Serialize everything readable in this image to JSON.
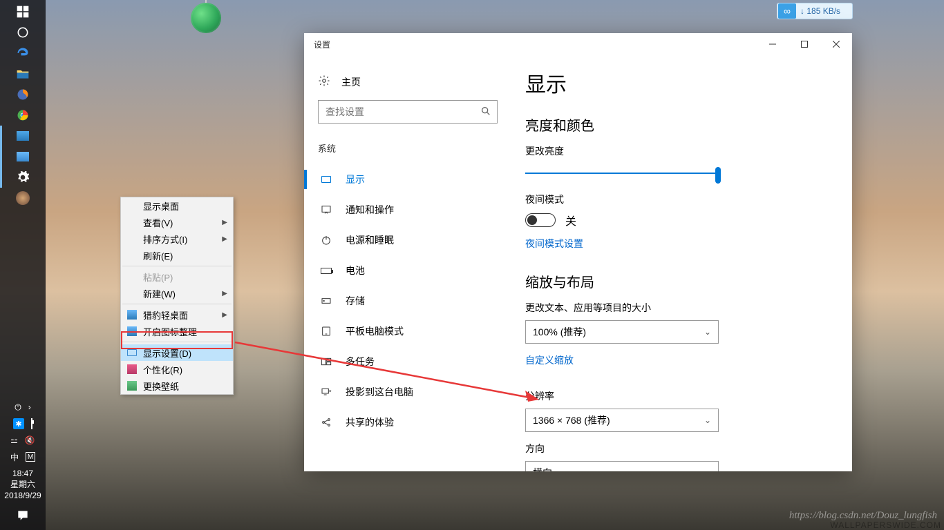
{
  "taskbar": {
    "clock_time": "18:47",
    "clock_day": "星期六",
    "clock_date": "2018/9/29",
    "ime": "中",
    "ime2": "M"
  },
  "netwidget": {
    "speed": "185 KB/s",
    "arrow": "↓"
  },
  "ctxmenu": {
    "items": [
      {
        "label": "显示桌面",
        "arrow": false
      },
      {
        "label": "查看(V)",
        "arrow": true
      },
      {
        "label": "排序方式(I)",
        "arrow": true
      },
      {
        "label": "刷新(E)",
        "arrow": false
      }
    ],
    "items2": [
      {
        "label": "粘贴(P)",
        "disabled": true
      },
      {
        "label": "新建(W)",
        "arrow": true
      }
    ],
    "items3": [
      {
        "label": "猎豹轻桌面",
        "arrow": true,
        "ico": "color1"
      },
      {
        "label": "开启图标整理",
        "ico": "color2"
      }
    ],
    "items4": [
      {
        "label": "显示设置(D)",
        "ico": "display",
        "hl": true
      },
      {
        "label": "个性化(R)",
        "ico": "pers"
      },
      {
        "label": "更换壁纸",
        "ico": "wall"
      }
    ]
  },
  "settings": {
    "title": "设置",
    "nav": {
      "home": "主页",
      "search_placeholder": "查找设置",
      "section": "系统",
      "items": [
        "显示",
        "通知和操作",
        "电源和睡眠",
        "电池",
        "存储",
        "平板电脑模式",
        "多任务",
        "投影到这台电脑",
        "共享的体验"
      ]
    },
    "content": {
      "h1": "显示",
      "section1": "亮度和颜色",
      "brightness_label": "更改亮度",
      "night_label": "夜间模式",
      "toggle_state": "关",
      "night_link": "夜间模式设置",
      "section2": "缩放与布局",
      "scale_label": "更改文本、应用等项目的大小",
      "scale_value": "100% (推荐)",
      "custom_scale": "自定义缩放",
      "res_label": "分辨率",
      "res_value": "1366 × 768 (推荐)",
      "orient_label": "方向",
      "orient_value": "横向"
    }
  },
  "watermark": "https://blog.csdn.net/Douz_lungfish",
  "watermark2": "WALLPAPERSWIDE.COM"
}
